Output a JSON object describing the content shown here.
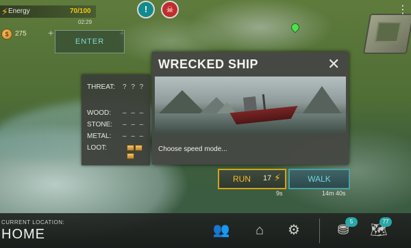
{
  "hud": {
    "energy_label": "Energy",
    "energy_value": "70/100",
    "timer": "02:29",
    "coins": "275",
    "alert_icons": [
      "exclamation-icon",
      "skull-icon"
    ]
  },
  "map": {
    "enter_label": "ENTER"
  },
  "stats": {
    "threat_label": "THREAT:",
    "threat_value": "? ? ?",
    "wood_label": "WOOD:",
    "wood_value": "– – –",
    "stone_label": "STONE:",
    "stone_value": "– – –",
    "metal_label": "METAL:",
    "metal_value": "– – –",
    "loot_label": "LOOT:",
    "loot_boxes": 3
  },
  "dialog": {
    "title": "WRECKED SHIP",
    "subtitle": "Choose speed mode..."
  },
  "speed": {
    "run_label": "RUN",
    "run_cost": "17",
    "run_time": "9s",
    "walk_label": "WALK",
    "walk_time": "14m 40s"
  },
  "bottom": {
    "location_label": "CURRENT LOCATION:",
    "location_value": "HOME",
    "resources_badge": "5",
    "map_badge": "77"
  },
  "colors": {
    "energy": "#f2c41a",
    "run_border": "#d4a21a",
    "walk_border": "#4aa0a4",
    "badge": "#2aa7a7"
  }
}
